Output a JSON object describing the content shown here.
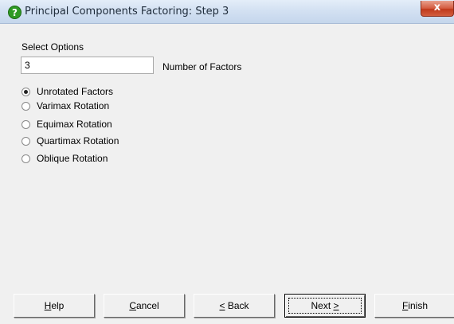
{
  "window": {
    "title": "Principal Components Factoring: Step 3",
    "close_glyph": "x"
  },
  "options": {
    "section_label": "Select Options",
    "factors_value": "3",
    "factors_label": "Number of Factors",
    "rotation": [
      {
        "label": "Unrotated Factors",
        "checked": true
      },
      {
        "label": "Varimax Rotation",
        "checked": false
      },
      {
        "label": "Equimax Rotation",
        "checked": false
      },
      {
        "label": "Quartimax Rotation",
        "checked": false
      },
      {
        "label": "Oblique Rotation",
        "checked": false
      }
    ]
  },
  "buttons": {
    "help": {
      "mnemonic": "H",
      "rest": "elp"
    },
    "cancel": {
      "mnemonic": "C",
      "rest": "ancel"
    },
    "back": {
      "mnemonic": "<",
      "rest": " Back"
    },
    "next": {
      "prefix": "Next ",
      "mnemonic": ">"
    },
    "finish": {
      "mnemonic": "F",
      "rest": "inish"
    }
  },
  "colors": {
    "dialog_bg": "#f0f0f0",
    "icon_green": "#2f9a24",
    "close_red": "#c0391b"
  },
  "icons": {
    "title_icon": "help-question-icon",
    "close": "close-icon"
  }
}
